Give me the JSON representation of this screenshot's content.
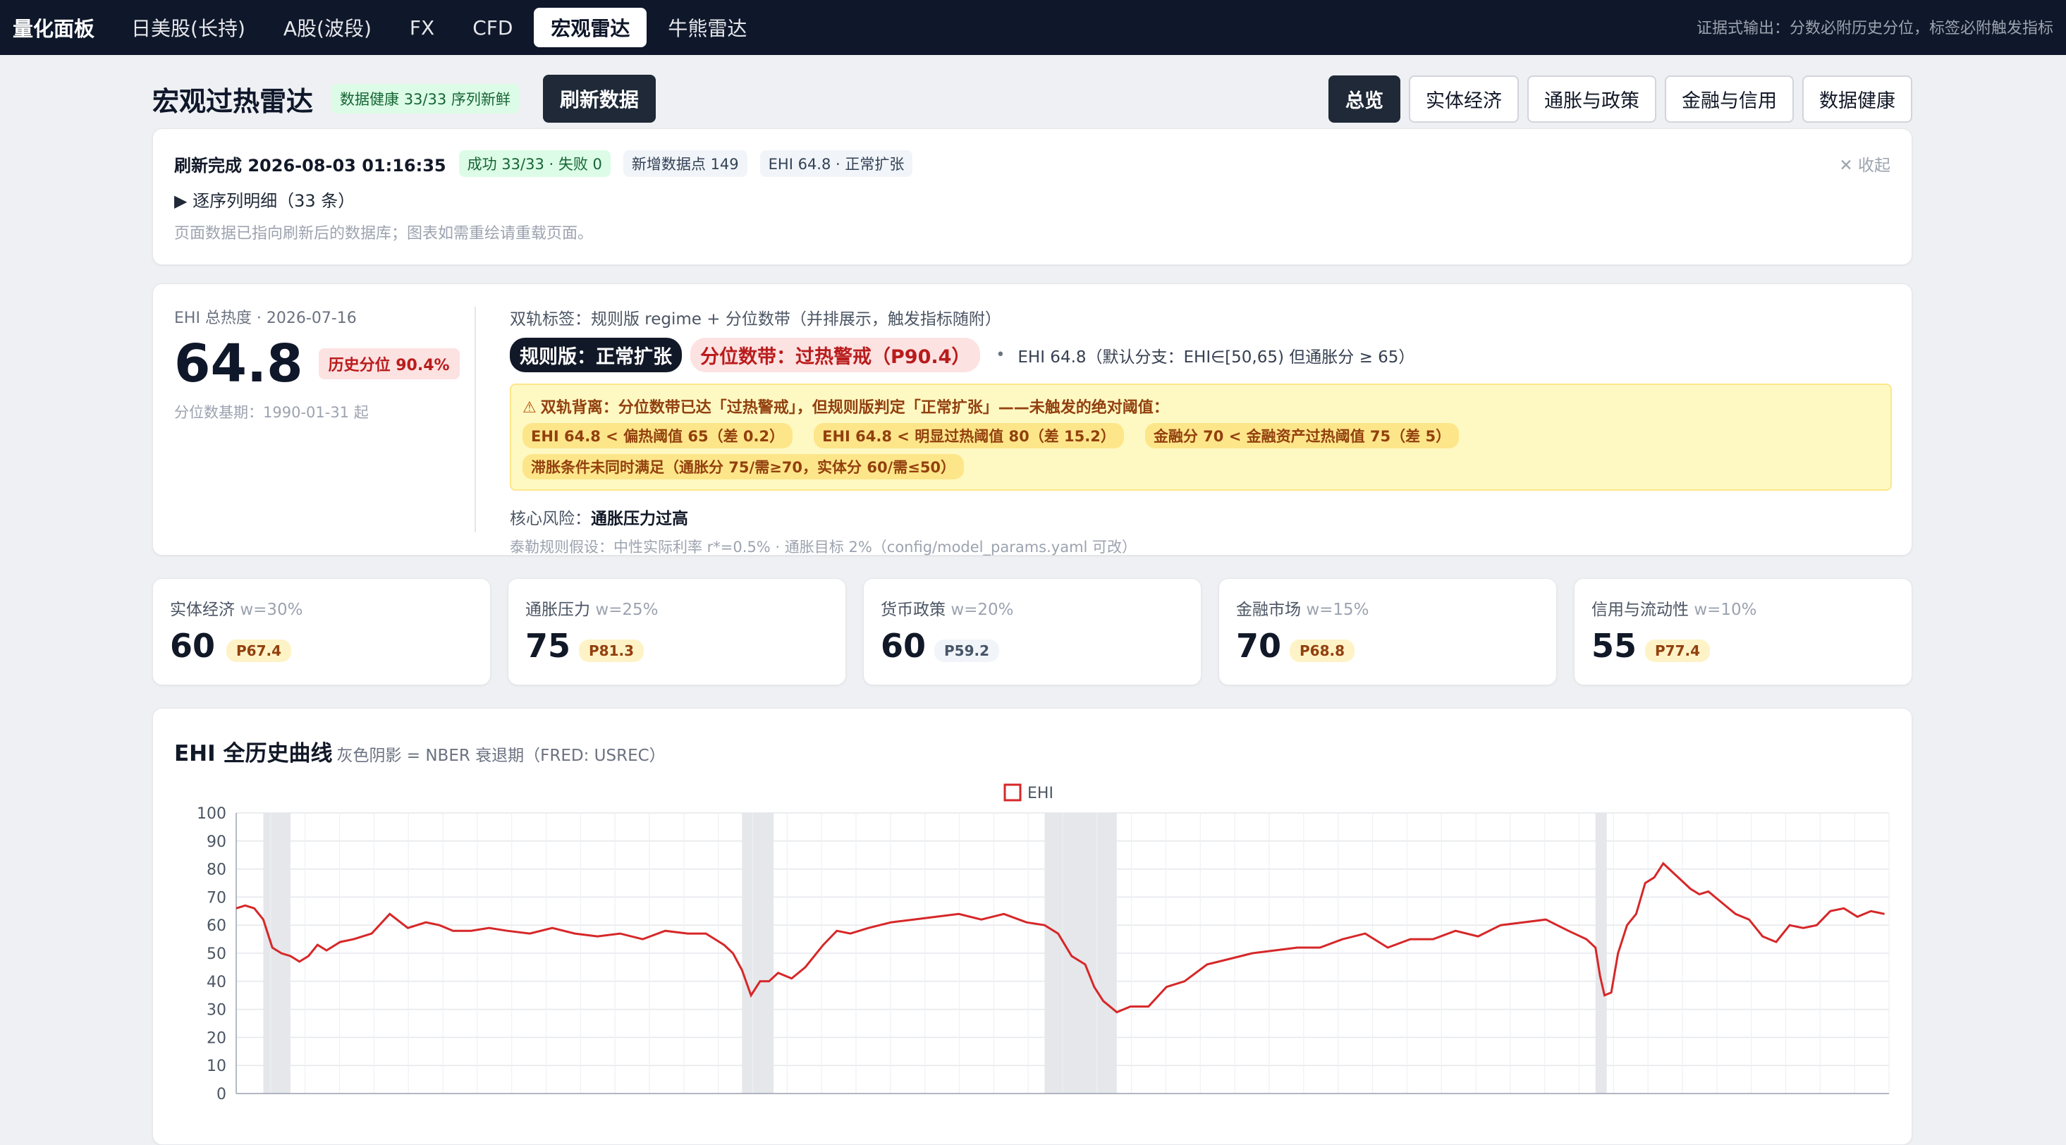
{
  "nav": {
    "brand": "量化面板",
    "tabs": [
      "日美股(长持)",
      "A股(波段)",
      "FX",
      "CFD",
      "宏观雷达",
      "牛熊雷达"
    ],
    "active_index": 4,
    "right_note": "证据式输出：分数必附历史分位，标签必附触发指标"
  },
  "header": {
    "title": "宏观过热雷达",
    "health_badge": "数据健康 33/33 序列新鲜",
    "refresh_label": "刷新数据",
    "tabs": [
      "总览",
      "实体经济",
      "通胀与政策",
      "金融与信用",
      "数据健康"
    ],
    "active_tab": 0
  },
  "refresh": {
    "done": "刷新完成 2026-08-03 01:16:35",
    "status": "成功 33/33 · 失败 0",
    "new_points": "新增数据点 149",
    "ehi_state": "EHI 64.8 · 正常扩张",
    "close_label": "收起",
    "detail_label": "▶ 逐序列明细（33 条）",
    "note": "页面数据已指向刷新后的数据库；图表如需重绘请重载页面。"
  },
  "ehi": {
    "label": "EHI 总热度 · 2026-07-16",
    "score": "64.8",
    "percentile_badge": "历史分位 90.4%",
    "base_note": "分位数基期：1990-01-31 起",
    "dual_label": "双轨标签：规则版 regime + 分位数带（并排展示，触发指标随附）",
    "rule_tag": "规则版：正常扩张",
    "band_tag": "分位数带：过热警戒（P90.4）",
    "dot": "•",
    "default_note": "EHI 64.8（默认分支：EHI∈[50,65) 但通胀分 ≥ 65）",
    "warn_title": "双轨背离：分位数带已达「过热警戒」，但规则版判定「正常扩张」——未触发的绝对阈值：",
    "warn_chips": [
      "EHI 64.8 < 偏热阈值 65（差 0.2）",
      "EHI 64.8 < 明显过热阈值 80（差 15.2）",
      "金融分 70 < 金融资产过热阈值 75（差 5）",
      "滞胀条件未同时满足（通胀分 75/需≥70，实体分 60/需≤50）"
    ],
    "risk_label": "核心风险：",
    "risk_value": "通胀压力过高",
    "taylor": "泰勒规则假设：中性实际利率 r*=0.5% · 通胀目标 2%（config/model_params.yaml 可改）"
  },
  "metrics": [
    {
      "name": "实体经济",
      "weight": "w=30%",
      "value": "60",
      "pct": "P67.4",
      "style": "yellow"
    },
    {
      "name": "通胀压力",
      "weight": "w=25%",
      "value": "75",
      "pct": "P81.3",
      "style": "yellow"
    },
    {
      "name": "货币政策",
      "weight": "w=20%",
      "value": "60",
      "pct": "P59.2",
      "style": "gray"
    },
    {
      "name": "金融市场",
      "weight": "w=15%",
      "value": "70",
      "pct": "P68.8",
      "style": "yellow"
    },
    {
      "name": "信用与流动性",
      "weight": "w=10%",
      "value": "55",
      "pct": "P77.4",
      "style": "yellow"
    }
  ],
  "chart": {
    "title": "EHI 全历史曲线",
    "subtitle": "灰色阴影 = NBER 衰退期（FRED: USREC）"
  },
  "chart_data": {
    "type": "line",
    "legend": [
      "EHI"
    ],
    "legend_placement": "top-center",
    "ylim": [
      0,
      100
    ],
    "yticks": [
      0,
      10,
      20,
      30,
      40,
      50,
      60,
      70,
      80,
      90,
      100
    ],
    "grid": true,
    "line_color": "#d62728",
    "shade_color": "#e5e7eb",
    "x_range": [
      1990.0,
      2026.6
    ],
    "recessions": [
      [
        1990.6,
        1991.2
      ],
      [
        2001.2,
        2001.9
      ],
      [
        2007.9,
        2009.5
      ],
      [
        2020.1,
        2020.35
      ]
    ],
    "series": [
      {
        "name": "EHI",
        "x": [
          1990.0,
          1990.2,
          1990.4,
          1990.6,
          1990.8,
          1991.0,
          1991.2,
          1991.4,
          1991.6,
          1991.8,
          1992.0,
          1992.3,
          1992.6,
          1993.0,
          1993.4,
          1993.8,
          1994.2,
          1994.5,
          1994.8,
          1995.2,
          1995.6,
          1996.0,
          1996.5,
          1997.0,
          1997.5,
          1998.0,
          1998.5,
          1999.0,
          1999.5,
          2000.0,
          2000.4,
          2000.8,
          2001.0,
          2001.2,
          2001.4,
          2001.6,
          2001.8,
          2002.0,
          2002.3,
          2002.6,
          2003.0,
          2003.3,
          2003.6,
          2004.0,
          2004.5,
          2005.0,
          2005.5,
          2006.0,
          2006.5,
          2007.0,
          2007.5,
          2007.9,
          2008.2,
          2008.5,
          2008.8,
          2009.0,
          2009.2,
          2009.5,
          2009.8,
          2010.2,
          2010.6,
          2011.0,
          2011.5,
          2012.0,
          2012.5,
          2013.0,
          2013.5,
          2014.0,
          2014.5,
          2015.0,
          2015.5,
          2016.0,
          2016.5,
          2017.0,
          2017.5,
          2018.0,
          2018.5,
          2019.0,
          2019.5,
          2019.9,
          2020.1,
          2020.2,
          2020.3,
          2020.45,
          2020.6,
          2020.8,
          2021.0,
          2021.2,
          2021.4,
          2021.6,
          2021.8,
          2022.0,
          2022.2,
          2022.4,
          2022.6,
          2022.9,
          2023.2,
          2023.5,
          2023.8,
          2024.1,
          2024.4,
          2024.7,
          2025.0,
          2025.3,
          2025.6,
          2025.9,
          2026.2,
          2026.5
        ],
        "values": [
          66,
          67,
          66,
          62,
          52,
          50,
          49,
          47,
          49,
          53,
          51,
          54,
          55,
          57,
          64,
          59,
          61,
          60,
          58,
          58,
          59,
          58,
          57,
          59,
          57,
          56,
          57,
          55,
          58,
          57,
          57,
          53,
          50,
          44,
          35,
          40,
          40,
          43,
          41,
          45,
          53,
          58,
          57,
          59,
          61,
          62,
          63,
          64,
          62,
          64,
          61,
          60,
          57,
          49,
          46,
          38,
          33,
          29,
          31,
          31,
          38,
          40,
          46,
          48,
          50,
          51,
          52,
          52,
          55,
          57,
          52,
          55,
          55,
          58,
          56,
          60,
          61,
          62,
          58,
          55,
          52,
          42,
          35,
          36,
          50,
          60,
          64,
          75,
          77,
          82,
          79,
          76,
          73,
          71,
          72,
          68,
          64,
          62,
          56,
          54,
          60,
          59,
          60,
          65,
          66,
          63,
          65,
          64
        ]
      }
    ]
  }
}
